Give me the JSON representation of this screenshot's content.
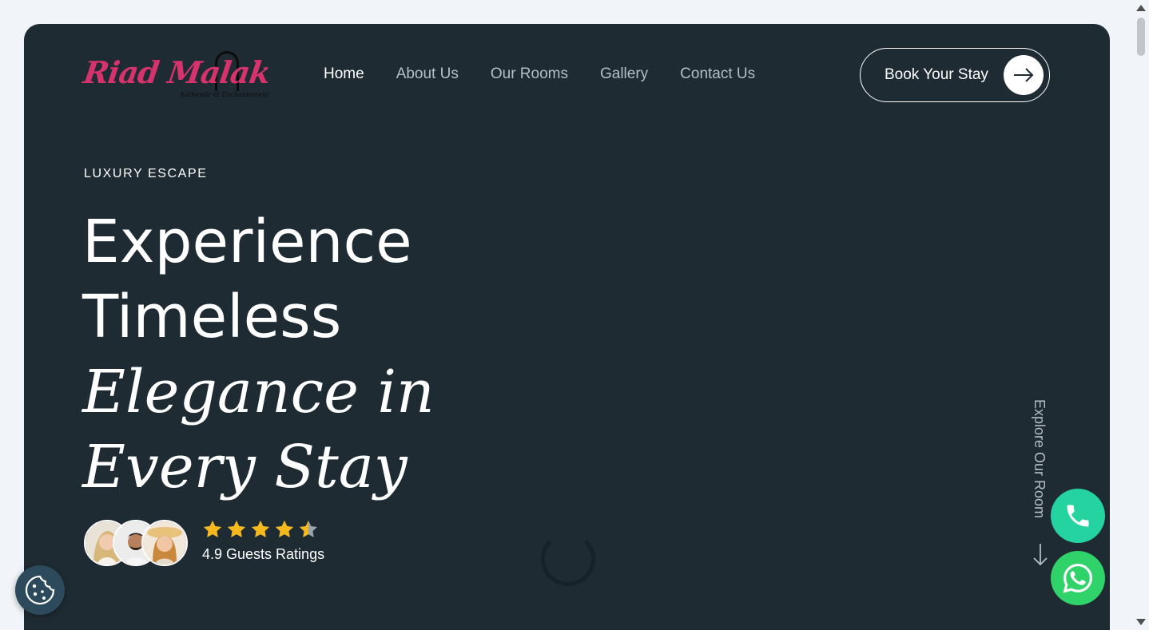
{
  "brand": {
    "logo_text": "Riad Malak",
    "logo_tagline": "Authentic et Enchantement",
    "logo_color": "#d6336c"
  },
  "nav": {
    "items": [
      {
        "label": "Home",
        "active": true
      },
      {
        "label": "About Us",
        "active": false
      },
      {
        "label": "Our Rooms",
        "active": false
      },
      {
        "label": "Gallery",
        "active": false
      },
      {
        "label": "Contact Us",
        "active": false
      }
    ],
    "cta_label": "Book Your Stay",
    "cta_icon": "arrow-right-icon"
  },
  "hero": {
    "eyebrow": "LUXURY ESCAPE",
    "headline_line1": "Experience",
    "headline_line2": "Timeless",
    "headline_line3": "Elegance in",
    "headline_line4": "Every Stay",
    "rating_value": 4.5,
    "rating_max": 5,
    "rating_text": "4.9 Guests Ratings",
    "explore_label": "Explore Our Room"
  },
  "floating": {
    "phone_icon": "phone-icon",
    "whatsapp_icon": "whatsapp-icon",
    "cookie_icon": "cookie-icon"
  },
  "colors": {
    "hero_bg": "#1f2b33",
    "page_bg": "#f1f5f9",
    "star": "#f6b91c",
    "phone": "#25d3a0",
    "whatsapp": "#2fd36a",
    "cookie": "#2c4a5c"
  }
}
